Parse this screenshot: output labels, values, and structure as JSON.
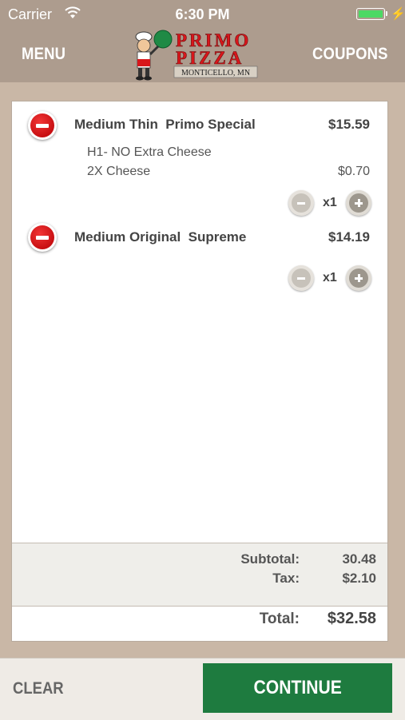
{
  "status_bar": {
    "carrier": "Carrier",
    "time": "6:30 PM",
    "battery_color": "#4cd964",
    "icons": [
      "wifi-icon",
      "battery-icon",
      "charging-bolt-icon"
    ]
  },
  "nav": {
    "menu_label": "MENU",
    "coupons_label": "COUPONS",
    "logo": {
      "line1": "PRIMO",
      "line2": "PIZZA",
      "location": "MONTICELLO, MN"
    }
  },
  "cart": {
    "items": [
      {
        "name": "Medium Thin  Primo Special",
        "price": "$15.59",
        "modifiers": [
          {
            "label": "H1- NO Extra Cheese",
            "price": ""
          },
          {
            "label": "2X Cheese",
            "price": "$0.70"
          }
        ],
        "quantity": "x1"
      },
      {
        "name": "Medium Original  Supreme",
        "price": "$14.19",
        "modifiers": [],
        "quantity": "x1"
      }
    ],
    "subtotal_label": "Subtotal:",
    "subtotal_value": "30.48",
    "tax_label": "Tax:",
    "tax_value": "$2.10",
    "total_label": "Total:",
    "total_value": "$32.58"
  },
  "footer": {
    "clear_label": "CLEAR",
    "continue_label": "CONTINUE"
  },
  "colors": {
    "header_bg": "#ad9c8e",
    "page_bg": "#c9b7a6",
    "continue_bg": "#1e7b3f",
    "remove_red": "#d11a1d",
    "logo_red": "#d8161b"
  }
}
